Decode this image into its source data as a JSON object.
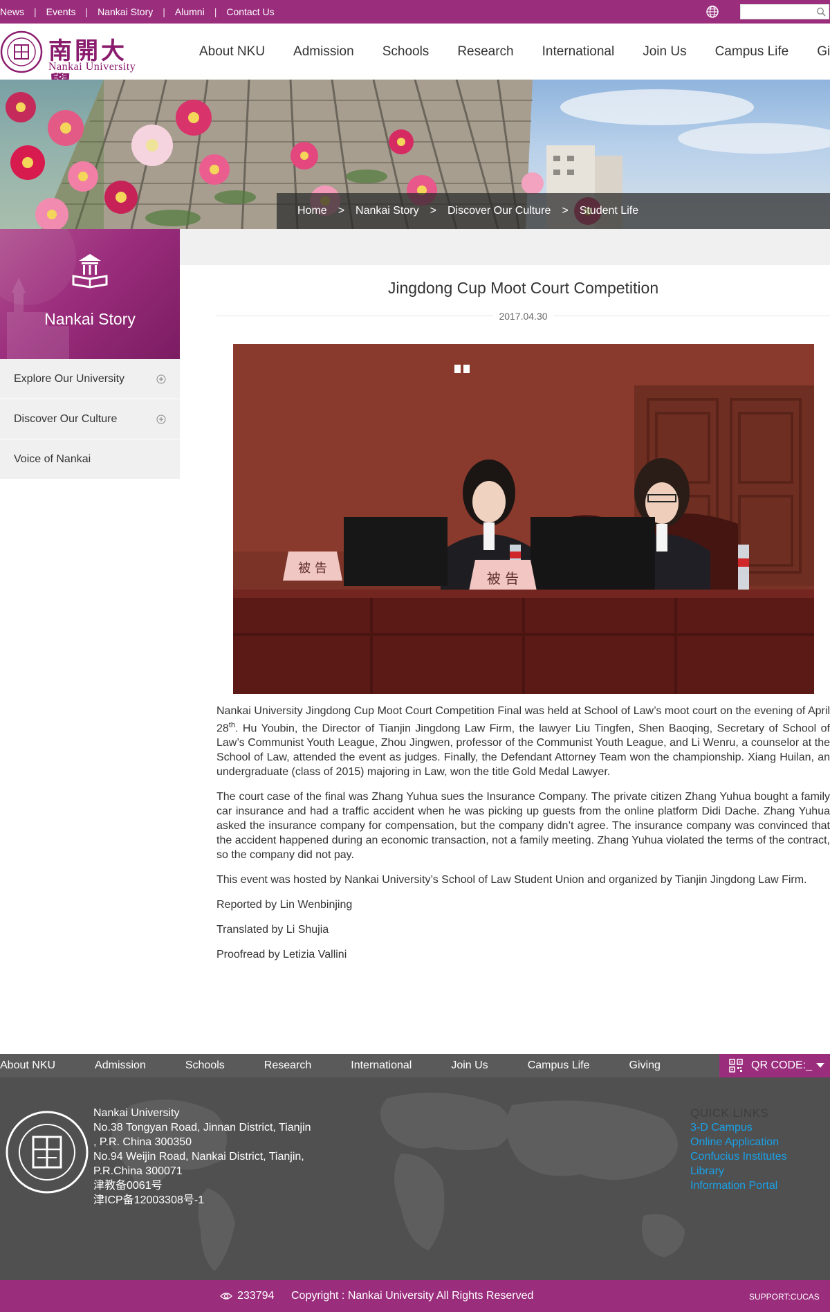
{
  "topbar": {
    "links": [
      "News",
      "Events",
      "Nankai Story",
      "Alumni",
      "Contact Us"
    ],
    "search_placeholder": ""
  },
  "logo": {
    "cn": "南開大學",
    "en": "Nankai University"
  },
  "nav": [
    "About NKU",
    "Admission",
    "Schools",
    "Research",
    "International",
    "Join Us",
    "Campus Life",
    "Giving"
  ],
  "breadcrumb": [
    "Home",
    "Nankai Story",
    "Discover Our Culture",
    "Student Life"
  ],
  "breadcrumb_sep": ">",
  "sidebar": {
    "title": "Nankai Story",
    "items": [
      {
        "label": "Explore Our University",
        "expandable": true
      },
      {
        "label": "Discover Our Culture",
        "expandable": true
      },
      {
        "label": "Voice of Nankai",
        "expandable": false
      }
    ]
  },
  "article": {
    "title": "Jingdong Cup Moot Court Competition",
    "date": "2017.04.30",
    "photo_placard": "被 告",
    "p1_a": "Nankai University Jingdong Cup Moot Court Competition Final was held at School of Law’s moot court on the evening of April 28",
    "p1_sup": "th",
    "p1_b": ". Hu Youbin, the Director of Tianjin Jingdong Law Firm, the lawyer Liu Tingfen, Shen Baoqing, Secretary of School of Law’s Communist Youth League, Zhou Jingwen, professor of the Communist Youth League, and Li Wenru, a counselor at the School of Law, attended the event as judges. Finally, the Defendant Attorney Team won the championship. Xiang Huilan, an undergraduate (class of 2015) majoring in Law, won the title Gold Medal Lawyer.",
    "p2": "The court case of the final was Zhang Yuhua sues the Insurance Company. The private citizen Zhang Yuhua bought a family car insurance and had a traffic accident when he was picking up guests from the online platform Didi Dache. Zhang Yuhua asked the insurance company for compensation, but the company didn’t agree. The insurance company was convinced that the accident happened during an economic transaction, not a family meeting. Zhang Yuhua violated the terms of the contract, so the company did not pay.",
    "p3": "This event was hosted by Nankai University’s School of Law Student Union and organized by Tianjin Jingdong Law Firm.",
    "p4": "Reported by Lin Wenbinjing",
    "p5": "Translated by Li Shujia",
    "p6": "Proofread by Letizia Vallini"
  },
  "footer": {
    "nav": [
      "About NKU",
      "Admission",
      "Schools",
      "Research",
      "International",
      "Join Us",
      "Campus Life",
      "Giving"
    ],
    "qr_label": "QR CODE:_",
    "address": [
      "Nankai University",
      "No.38 Tongyan Road, Jinnan District, Tianjin",
      ", P.R. China 300350",
      "No.94 Weijin Road,  Nankai District, Tianjin,",
      "P.R.China  300071",
      "津教备0061号",
      "津ICP备12003308号-1"
    ],
    "quick_links_title": "QUICK LINKS",
    "quick_links": [
      "3-D Campus",
      "Online Application",
      "Confucius Institutes",
      "Library",
      "Information Portal"
    ],
    "visits": "233794",
    "copyright": "Copyright : Nankai University All Rights Reserved",
    "support": "SUPPORT:CUCAS"
  },
  "colors": {
    "brand": "#9b2d7d",
    "footer_dark": "#505050",
    "link_blue": "#1aa0e6"
  }
}
